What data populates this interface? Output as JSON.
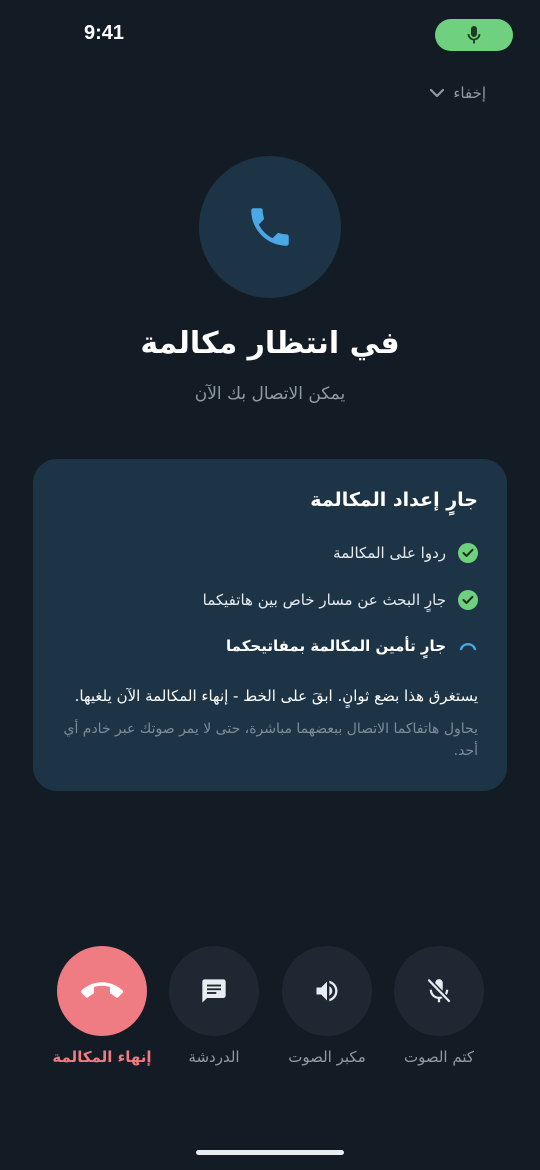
{
  "status_bar": {
    "time": "9:41",
    "mic_icon": "mic-icon",
    "mic_pill_color": "#6fd07f"
  },
  "header": {
    "hide_label": "إخفاء",
    "hide_icon": "chevron-down-icon"
  },
  "call": {
    "icon": "phone-icon",
    "title": "في انتظار مكالمة",
    "subtitle": "يمكن الاتصال بك الآن"
  },
  "setup_card": {
    "title": "جارٍ إعداد المكالمة",
    "steps": [
      {
        "label": "ردوا على المكالمة",
        "state": "done"
      },
      {
        "label": "جارٍ البحث عن مسار خاص بين هاتفيكما",
        "state": "done"
      },
      {
        "label": "جارٍ تأمين المكالمة بمفاتيحكما",
        "state": "in-progress"
      }
    ],
    "note": "يستغرق هذا بضع ثوانٍ. ابقَ على الخط - إنهاء المكالمة الآن يلغيها.",
    "privacy_note": "يحاول هاتفاكما الاتصال ببعضهما مباشرة، حتى لا يمر صوتك عبر خادم أي أحد."
  },
  "controls": {
    "mute": {
      "label": "كتم الصوت",
      "icon": "mic-off-icon"
    },
    "speaker": {
      "label": "مكبر الصوت",
      "icon": "speaker-icon"
    },
    "chat": {
      "label": "الدردشة",
      "icon": "chat-icon"
    },
    "end_call": {
      "label": "إنهاء المكالمة",
      "icon": "end-call-icon"
    }
  },
  "colors": {
    "background": "#131c25",
    "card": "#1d3446",
    "accent_blue": "#4aa8e6",
    "success_green": "#6fd07f",
    "end_call_red": "#ef7b83"
  }
}
